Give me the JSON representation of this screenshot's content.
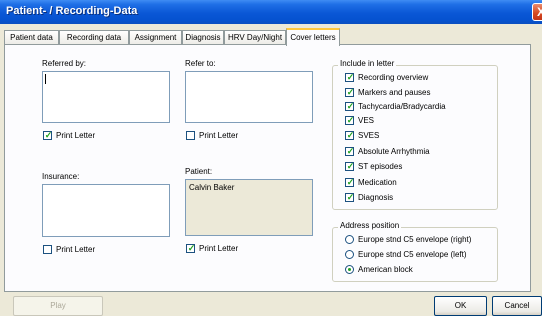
{
  "window": {
    "title": "Patient- / Recording-Data",
    "close_label": "X"
  },
  "tabs": [
    {
      "label": "Patient data"
    },
    {
      "label": "Recording data"
    },
    {
      "label": "Assignment"
    },
    {
      "label": "Diagnosis"
    },
    {
      "label": "HRV Day/Night"
    },
    {
      "label": "Cover letters",
      "active": true
    }
  ],
  "referred_by": {
    "label": "Referred by:",
    "value": "",
    "print_label": "Print Letter",
    "print_checked": true
  },
  "refer_to": {
    "label": "Refer to:",
    "value": "",
    "print_label": "Print Letter",
    "print_checked": false
  },
  "insurance": {
    "label": "Insurance:",
    "value": "",
    "print_label": "Print Letter",
    "print_checked": false
  },
  "patient": {
    "label": "Patient:",
    "value": "Calvin Baker",
    "print_label": "Print Letter",
    "print_checked": true
  },
  "include": {
    "legend": "Include in letter",
    "items": [
      {
        "label": "Recording overview",
        "checked": true
      },
      {
        "label": "Markers and pauses",
        "checked": true
      },
      {
        "label": "Tachycardia/Bradycardia",
        "checked": true
      },
      {
        "label": "VES",
        "checked": true
      },
      {
        "label": "SVES",
        "checked": true
      },
      {
        "label": "Absolute Arrhythmia",
        "checked": true
      },
      {
        "label": "ST episodes",
        "checked": true
      },
      {
        "label": "Medication",
        "checked": true
      },
      {
        "label": "Diagnosis",
        "checked": true
      }
    ]
  },
  "address": {
    "legend": "Address position",
    "options": [
      {
        "label": "Europe stnd C5 envelope (right)",
        "selected": false
      },
      {
        "label": "Europe stnd C5 envelope (left)",
        "selected": false
      },
      {
        "label": "American block",
        "selected": true
      }
    ]
  },
  "buttons": {
    "play": "Play",
    "ok": "OK",
    "cancel": "Cancel"
  },
  "colors": {
    "title_bar": "#0a57d6",
    "window_bg": "#ece9d8",
    "check_mark": "#21a121",
    "active_tab_accent": "#ffc83c"
  }
}
